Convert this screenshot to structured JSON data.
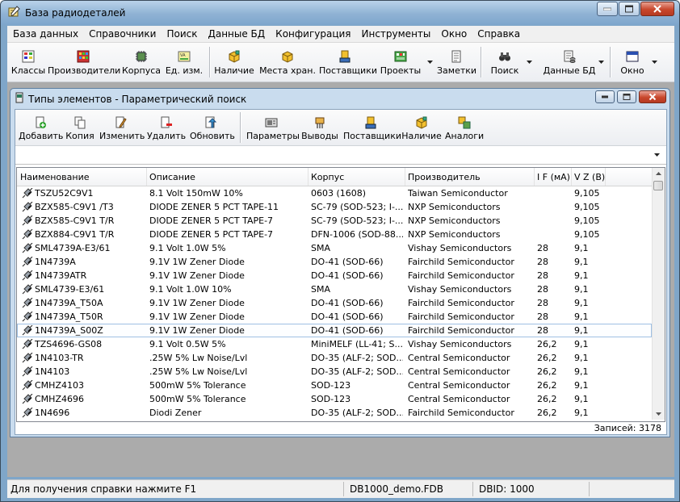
{
  "window": {
    "title": "База радиодеталей"
  },
  "menu": [
    "База данных",
    "Справочники",
    "Поиск",
    "Данные БД",
    "Конфигурация",
    "Инструменты",
    "Окно",
    "Справка"
  ],
  "toolbar": {
    "classes": "Классы",
    "manufacturers": "Производители",
    "packages": "Корпуса",
    "units": "Ед. изм.",
    "stock": "Наличие",
    "storage": "Места хран.",
    "suppliers": "Поставщики",
    "projects": "Проекты",
    "notes": "Заметки",
    "search": "Поиск",
    "dbdata": "Данные БД",
    "window": "Окно"
  },
  "child": {
    "title": "Типы элементов - Параметрический поиск",
    "toolbar": {
      "add": "Добавить",
      "copy": "Копия",
      "edit": "Изменить",
      "delete": "Удалить",
      "refresh": "Обновить",
      "params": "Параметры",
      "pins": "Выводы",
      "suppliers": "Поставщики",
      "stock": "Наличие",
      "analogs": "Аналоги"
    },
    "filter_value": ""
  },
  "grid": {
    "columns": [
      "Наименование",
      "Описание",
      "Корпус",
      "Производитель",
      "I F (мА)",
      "V Z (В)"
    ],
    "rows": [
      [
        "TSZU52C9V1",
        "8.1 Volt 150mW 10%",
        "0603 (1608)",
        "Taiwan Semiconductor",
        "",
        "9,105"
      ],
      [
        "BZX585-C9V1 /T3",
        "DIODE ZENER 5 PCT TAPE-11",
        "SC-79 (SOD-523; I-...",
        "NXP Semiconductors",
        "",
        "9,105"
      ],
      [
        "BZX585-C9V1 T/R",
        "DIODE ZENER 5 PCT TAPE-7",
        "SC-79 (SOD-523; I-...",
        "NXP Semiconductors",
        "",
        "9,105"
      ],
      [
        "BZX884-C9V1 T/R",
        "DIODE ZENER 5 PCT TAPE-7",
        "DFN-1006 (SOD-88...",
        "NXP Semiconductors",
        "",
        "9,105"
      ],
      [
        "SML4739A-E3/61",
        "9.1 Volt 1.0W 5%",
        "SMA",
        "Vishay Semiconductors",
        "28",
        "9,1"
      ],
      [
        "1N4739A",
        "9.1V 1W Zener Diode",
        "DO-41 (SOD-66)",
        "Fairchild Semiconductor",
        "28",
        "9,1"
      ],
      [
        "1N4739ATR",
        "9.1V 1W Zener Diode",
        "DO-41 (SOD-66)",
        "Fairchild Semiconductor",
        "28",
        "9,1"
      ],
      [
        "SML4739-E3/61",
        "9.1 Volt 1.0W 10%",
        "SMA",
        "Vishay Semiconductors",
        "28",
        "9,1"
      ],
      [
        "1N4739A_T50A",
        "9.1V 1W Zener Diode",
        "DO-41 (SOD-66)",
        "Fairchild Semiconductor",
        "28",
        "9,1"
      ],
      [
        "1N4739A_T50R",
        "9.1V 1W Zener Diode",
        "DO-41 (SOD-66)",
        "Fairchild Semiconductor",
        "28",
        "9,1"
      ],
      [
        "1N4739A_S00Z",
        "9.1V 1W Zener Diode",
        "DO-41 (SOD-66)",
        "Fairchild Semiconductor",
        "28",
        "9,1"
      ],
      [
        "TZS4696-GS08",
        "9.1 Volt 0.5W 5%",
        "MiniMELF (LL-41; S...",
        "Vishay Semiconductors",
        "26,2",
        "9,1"
      ],
      [
        "1N4103-TR",
        ".25W 5% Lw Noise/Lvl",
        "DO-35 (ALF-2; SOD...",
        "Central Semiconductor",
        "26,2",
        "9,1"
      ],
      [
        "1N4103",
        ".25W 5% Lw Noise/Lvl",
        "DO-35 (ALF-2; SOD...",
        "Central Semiconductor",
        "26,2",
        "9,1"
      ],
      [
        "CMHZ4103",
        "500mW 5% Tolerance",
        "SOD-123",
        "Central Semiconductor",
        "26,2",
        "9,1"
      ],
      [
        "CMHZ4696",
        "500mW 5% Tolerance",
        "SOD-123",
        "Central Semiconductor",
        "26,2",
        "9,1"
      ],
      [
        "1N4696",
        "Diodi Zener",
        "DO-35 (ALF-2; SOD...",
        "Fairchild Semiconductor",
        "26,2",
        "9,1"
      ]
    ],
    "selected_row": 10,
    "records": "Записей: 3178"
  },
  "status": {
    "help": "Для получения справки нажмите F1",
    "db": "DB1000_demo.FDB",
    "dbid": "DBID: 1000"
  }
}
